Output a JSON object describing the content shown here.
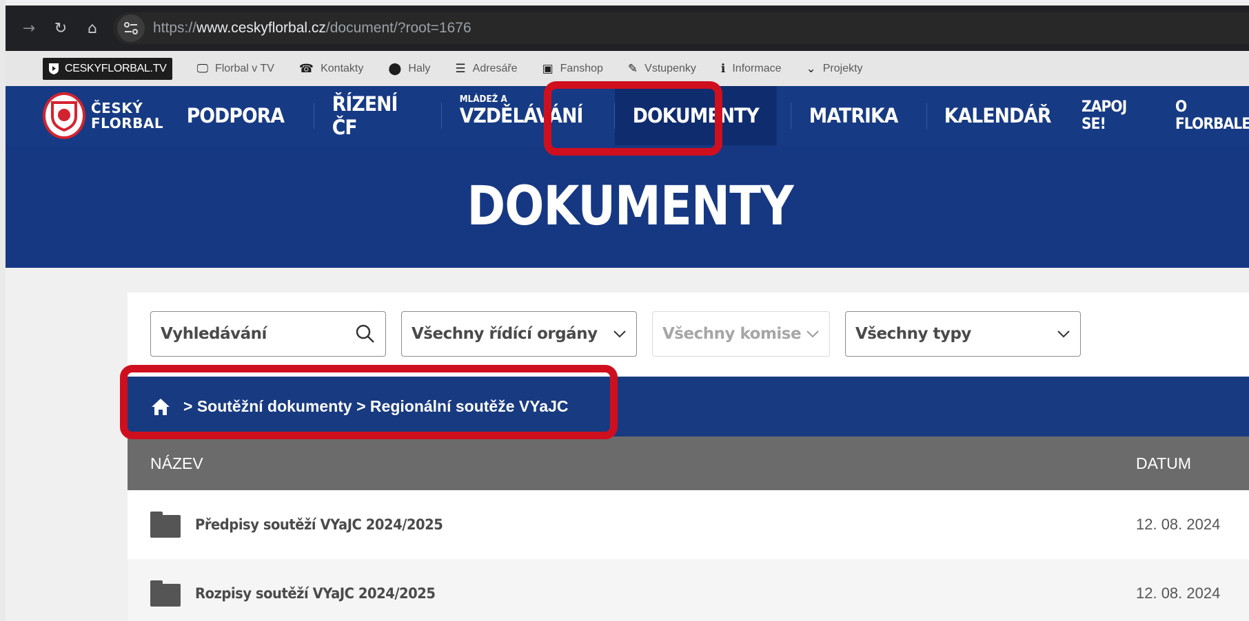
{
  "browser": {
    "url_scheme": "https://",
    "url_host": "www.ceskyflorbal.cz",
    "url_path": "/document/?root=1676"
  },
  "utility_bar": {
    "tv_label": "CESKYFLORBAL.TV",
    "items": [
      {
        "icon": "monitor-icon",
        "label": "Florbal v TV"
      },
      {
        "icon": "phone-book-icon",
        "label": "Kontakty"
      },
      {
        "icon": "map-pin-icon",
        "label": "Haly"
      },
      {
        "icon": "list-icon",
        "label": "Adresáře"
      },
      {
        "icon": "shopping-bag-icon",
        "label": "Fanshop"
      },
      {
        "icon": "ticket-icon",
        "label": "Vstupenky"
      },
      {
        "icon": "info-icon",
        "label": "Informace"
      },
      {
        "icon": "chevron-down-icon",
        "label": "Projekty"
      }
    ]
  },
  "main_nav": {
    "logo_line1": "ČESKÝ",
    "logo_line2": "FLORBAL",
    "items": [
      {
        "label": "PODPORA"
      },
      {
        "label": "ŘÍZENÍ ČF"
      },
      {
        "label": "VZDĚLÁVÁNÍ",
        "sup": "MLÁDEŽ A"
      },
      {
        "label": "DOKUMENTY",
        "active": true
      },
      {
        "label": "MATRIKA"
      },
      {
        "label": "KALENDÁŘ"
      }
    ],
    "right_items": [
      {
        "label": "ZAPOJ SE!"
      },
      {
        "label": "O FLORBALE"
      }
    ]
  },
  "hero": {
    "title": "DOKUMENTY"
  },
  "filters": {
    "search_placeholder": "Vyhledávání",
    "governing_bodies": "Všechny řídící orgány",
    "committees": "Všechny komise",
    "types": "Všechny typy"
  },
  "breadcrumb": {
    "text": "> Soutěžní dokumenty > Regionální soutěže VYaJC"
  },
  "table": {
    "headers": {
      "name": "NÁZEV",
      "date": "DATUM"
    },
    "rows": [
      {
        "name": "Předpisy soutěží VYaJC 2024/2025",
        "date": "12. 08. 2024"
      },
      {
        "name": "Rozpisy soutěží VYaJC 2024/2025",
        "date": "12. 08. 2024"
      }
    ]
  },
  "colors": {
    "brand_blue": "#173a84",
    "highlight_red": "#d00f1e"
  }
}
